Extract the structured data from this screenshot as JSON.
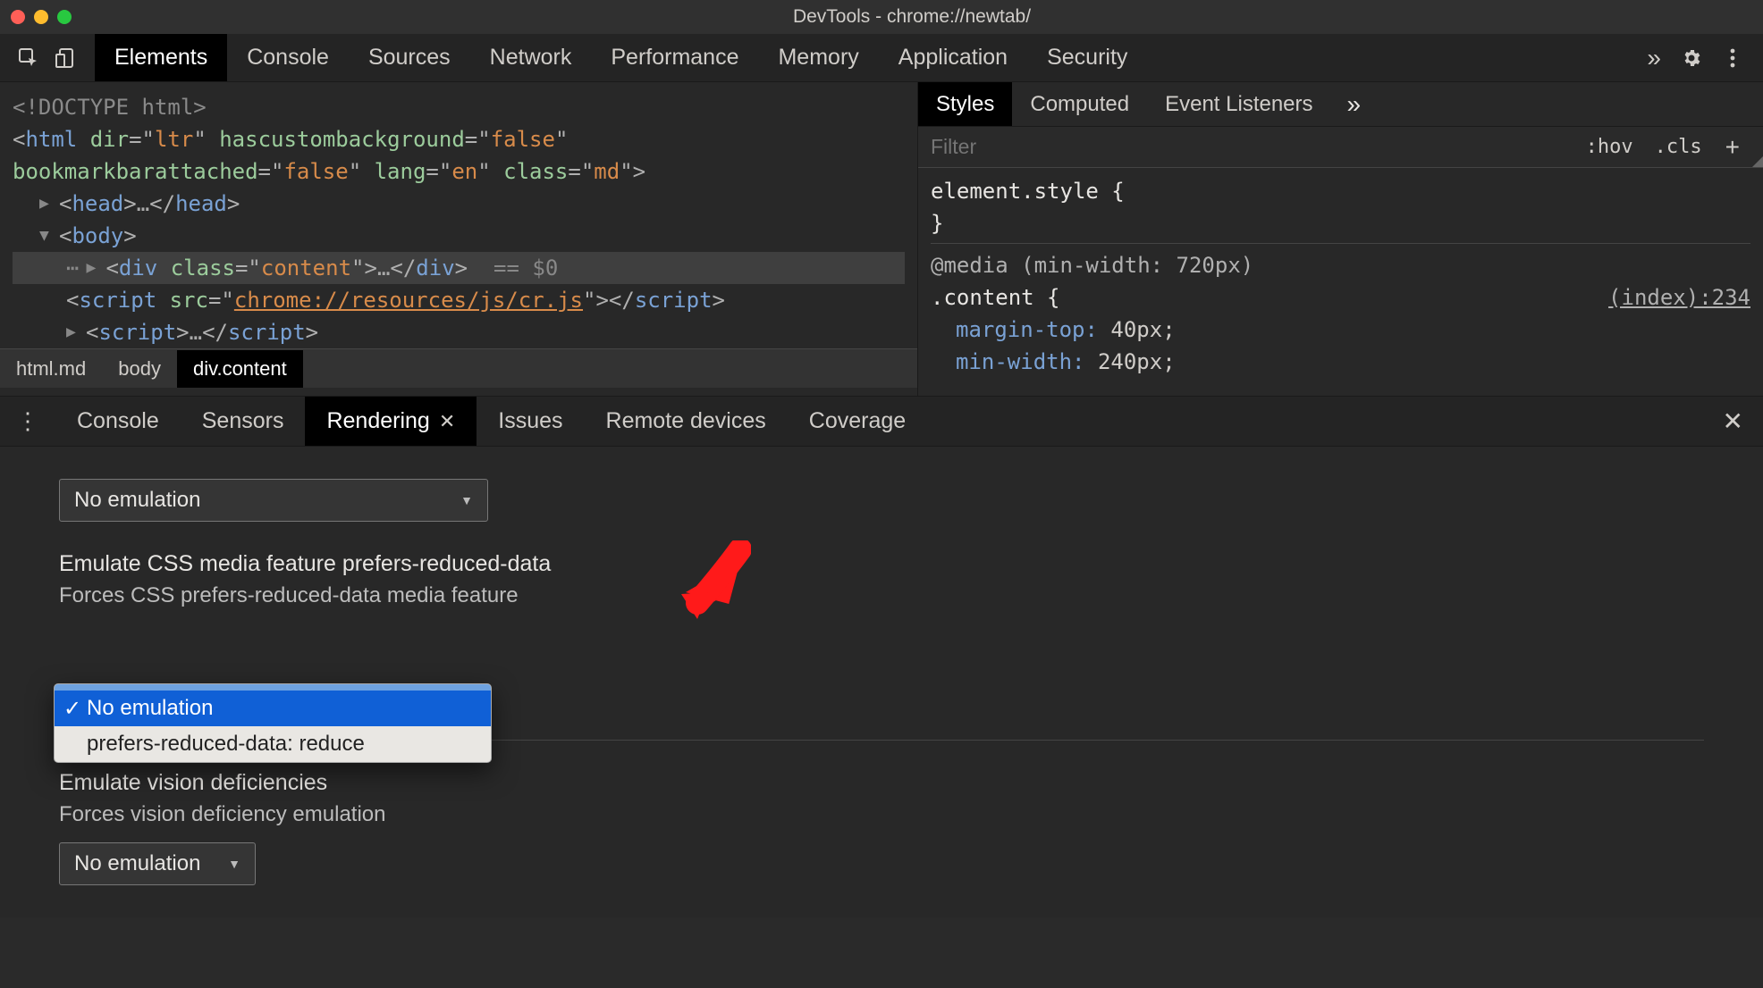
{
  "window_title": "DevTools - chrome://newtab/",
  "panel_tabs": [
    "Elements",
    "Console",
    "Sources",
    "Network",
    "Performance",
    "Memory",
    "Application",
    "Security"
  ],
  "panel_more_glyph": "»",
  "panel_active": 0,
  "code": {
    "doctype": "<!DOCTYPE html>",
    "html_attrs": {
      "dir": "ltr",
      "hascustombackground": "false",
      "bookmarkbarattached": "false",
      "lang": "en",
      "class": "md"
    },
    "head_collapsed": "…",
    "div_class": "content",
    "div_inner": "…",
    "eq_zero": "== $0",
    "script_src": "chrome://resources/js/cr.js",
    "script2_inner": "…"
  },
  "breadcrumbs": [
    "html.md",
    "body",
    "div.content"
  ],
  "breadcrumb_active": 2,
  "styles_tabs": [
    "Styles",
    "Computed",
    "Event Listeners"
  ],
  "styles_tabs_more": "»",
  "styles_tab_active": 0,
  "filter_placeholder": "Filter",
  "hov": ":hov",
  "cls": ".cls",
  "plus": "+",
  "rule_element_style": "element.style {",
  "rule_element_style_close": "}",
  "rule_media": "@media (min-width: 720px)",
  "rule_selector": ".content {",
  "rule_source": "(index):234",
  "rule_props": [
    {
      "k": "margin-top",
      "v": "40px;"
    },
    {
      "k": "min-width",
      "v": "240px;"
    }
  ],
  "drawer_tabs": [
    "Console",
    "Sensors",
    "Rendering",
    "Issues",
    "Remote devices",
    "Coverage"
  ],
  "drawer_tab_active": 2,
  "rendering": {
    "top_select_value": "No emulation",
    "section1_title": "Emulate CSS media feature prefers-reduced-data",
    "section1_desc": "Forces CSS prefers-reduced-data media feature",
    "dd_options": [
      "No emulation",
      "prefers-reduced-data: reduce"
    ],
    "dd_selected": 0,
    "section2_title": "Emulate vision deficiencies",
    "section2_desc": "Forces vision deficiency emulation",
    "section2_select_value": "No emulation"
  }
}
